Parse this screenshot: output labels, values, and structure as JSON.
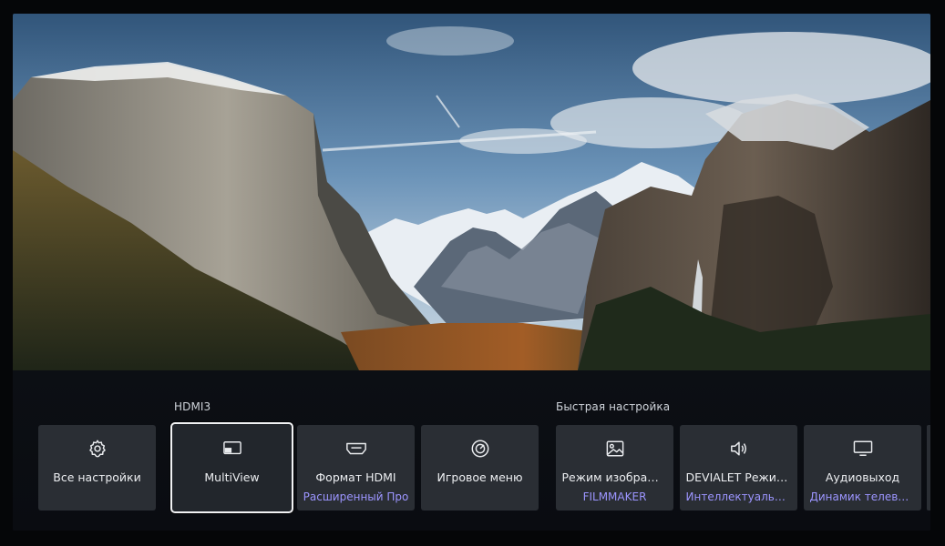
{
  "sections": {
    "input_label": "HDMI3",
    "quick_label": "Быстрая настройка"
  },
  "tiles": [
    {
      "label": "Все настройки",
      "sub": "",
      "icon": "gear-icon"
    },
    {
      "label": "MultiView",
      "sub": "",
      "icon": "multiview-icon"
    },
    {
      "label": "Формат HDMI",
      "sub": "Расширенный Про",
      "icon": "hdmi-icon"
    },
    {
      "label": "Игровое меню",
      "sub": "",
      "icon": "game-gauge-icon"
    },
    {
      "label": "Режим изображ…",
      "sub": "FILMMAKER",
      "icon": "picture-icon"
    },
    {
      "label": "DEVIALET Режим…",
      "sub": "Интеллектуальн…",
      "icon": "speaker-icon"
    },
    {
      "label": "Аудиовыход",
      "sub": "Динамик телеви…",
      "icon": "tv-icon"
    }
  ],
  "focused_tile": "MultiView",
  "colors": {
    "accent_sub": "#9c95ff",
    "tile_bg": "#2a2e34",
    "panel_bg": "#0c0f14"
  }
}
